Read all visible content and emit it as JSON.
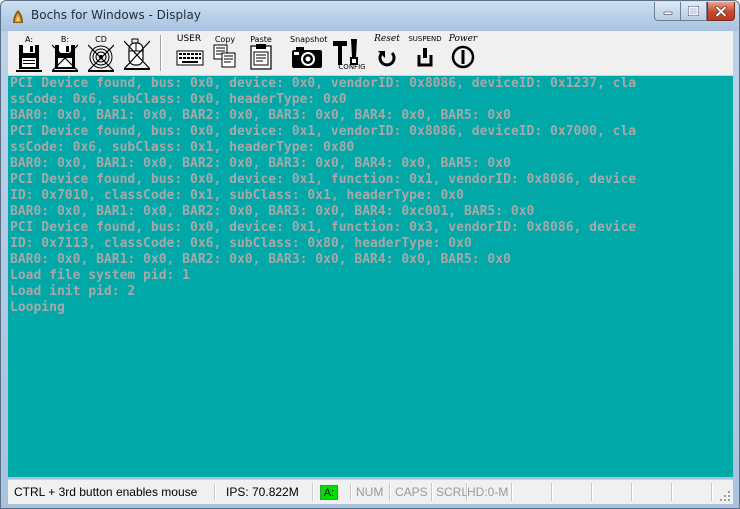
{
  "window": {
    "title": "Bochs for Windows - Display",
    "minimize_icon": "minimize-icon",
    "maximize_icon": "maximize-icon",
    "close_icon": "close-icon"
  },
  "toolbar": {
    "buttons": [
      {
        "label": "A:",
        "icon": "floppy-a-icon"
      },
      {
        "label": "B:",
        "icon": "floppy-b-icon"
      },
      {
        "label": "CD",
        "icon": "cdrom-icon"
      },
      {
        "label": "",
        "icon": "mouse-icon"
      },
      {
        "label": "USER",
        "icon": "keyboard-icon"
      },
      {
        "label": "Copy",
        "icon": "copy-icon"
      },
      {
        "label": "Paste",
        "icon": "paste-icon"
      },
      {
        "label": "Snapshot",
        "icon": "camera-icon"
      },
      {
        "label": "CONFIG",
        "icon": "config-icon"
      },
      {
        "label": "Reset",
        "icon": "reset-icon"
      },
      {
        "label": "SUSPEND",
        "icon": "suspend-icon"
      },
      {
        "label": "Power",
        "icon": "power-icon"
      }
    ]
  },
  "console": {
    "foreground": "#a8a8a8",
    "background": "#00a8a8",
    "lines": [
      "PCI Device found, bus: 0x0, device: 0x0, vendorID: 0x8086, deviceID: 0x1237, cla",
      "ssCode: 0x6, subClass: 0x0, headerType: 0x0",
      "BAR0: 0x0, BAR1: 0x0, BAR2: 0x0, BAR3: 0x0, BAR4: 0x0, BAR5: 0x0",
      "PCI Device found, bus: 0x0, device: 0x1, vendorID: 0x8086, deviceID: 0x7000, cla",
      "ssCode: 0x6, subClass: 0x1, headerType: 0x80",
      "BAR0: 0x0, BAR1: 0x0, BAR2: 0x0, BAR3: 0x0, BAR4: 0x0, BAR5: 0x0",
      "PCI Device found, bus: 0x0, device: 0x1, function: 0x1, vendorID: 0x8086, device",
      "ID: 0x7010, classCode: 0x1, subClass: 0x1, headerType: 0x0",
      "BAR0: 0x0, BAR1: 0x0, BAR2: 0x0, BAR3: 0x0, BAR4: 0xc001, BAR5: 0x0",
      "PCI Device found, bus: 0x0, device: 0x1, function: 0x3, vendorID: 0x8086, device",
      "ID: 0x7113, classCode: 0x6, subClass: 0x80, headerType: 0x0",
      "BAR0: 0x0, BAR1: 0x0, BAR2: 0x0, BAR3: 0x0, BAR4: 0x0, BAR5: 0x0",
      "Load file system pid: 1",
      "Load init pid: 2",
      "Looping"
    ]
  },
  "statusbar": {
    "hint": "CTRL + 3rd button enables mouse",
    "ips": "IPS: 70.822M",
    "drive": "A:",
    "drive_color": "#00e000",
    "num": "NUM",
    "caps": "CAPS",
    "scrl": "SCRL",
    "hd": "HD:0-M"
  }
}
